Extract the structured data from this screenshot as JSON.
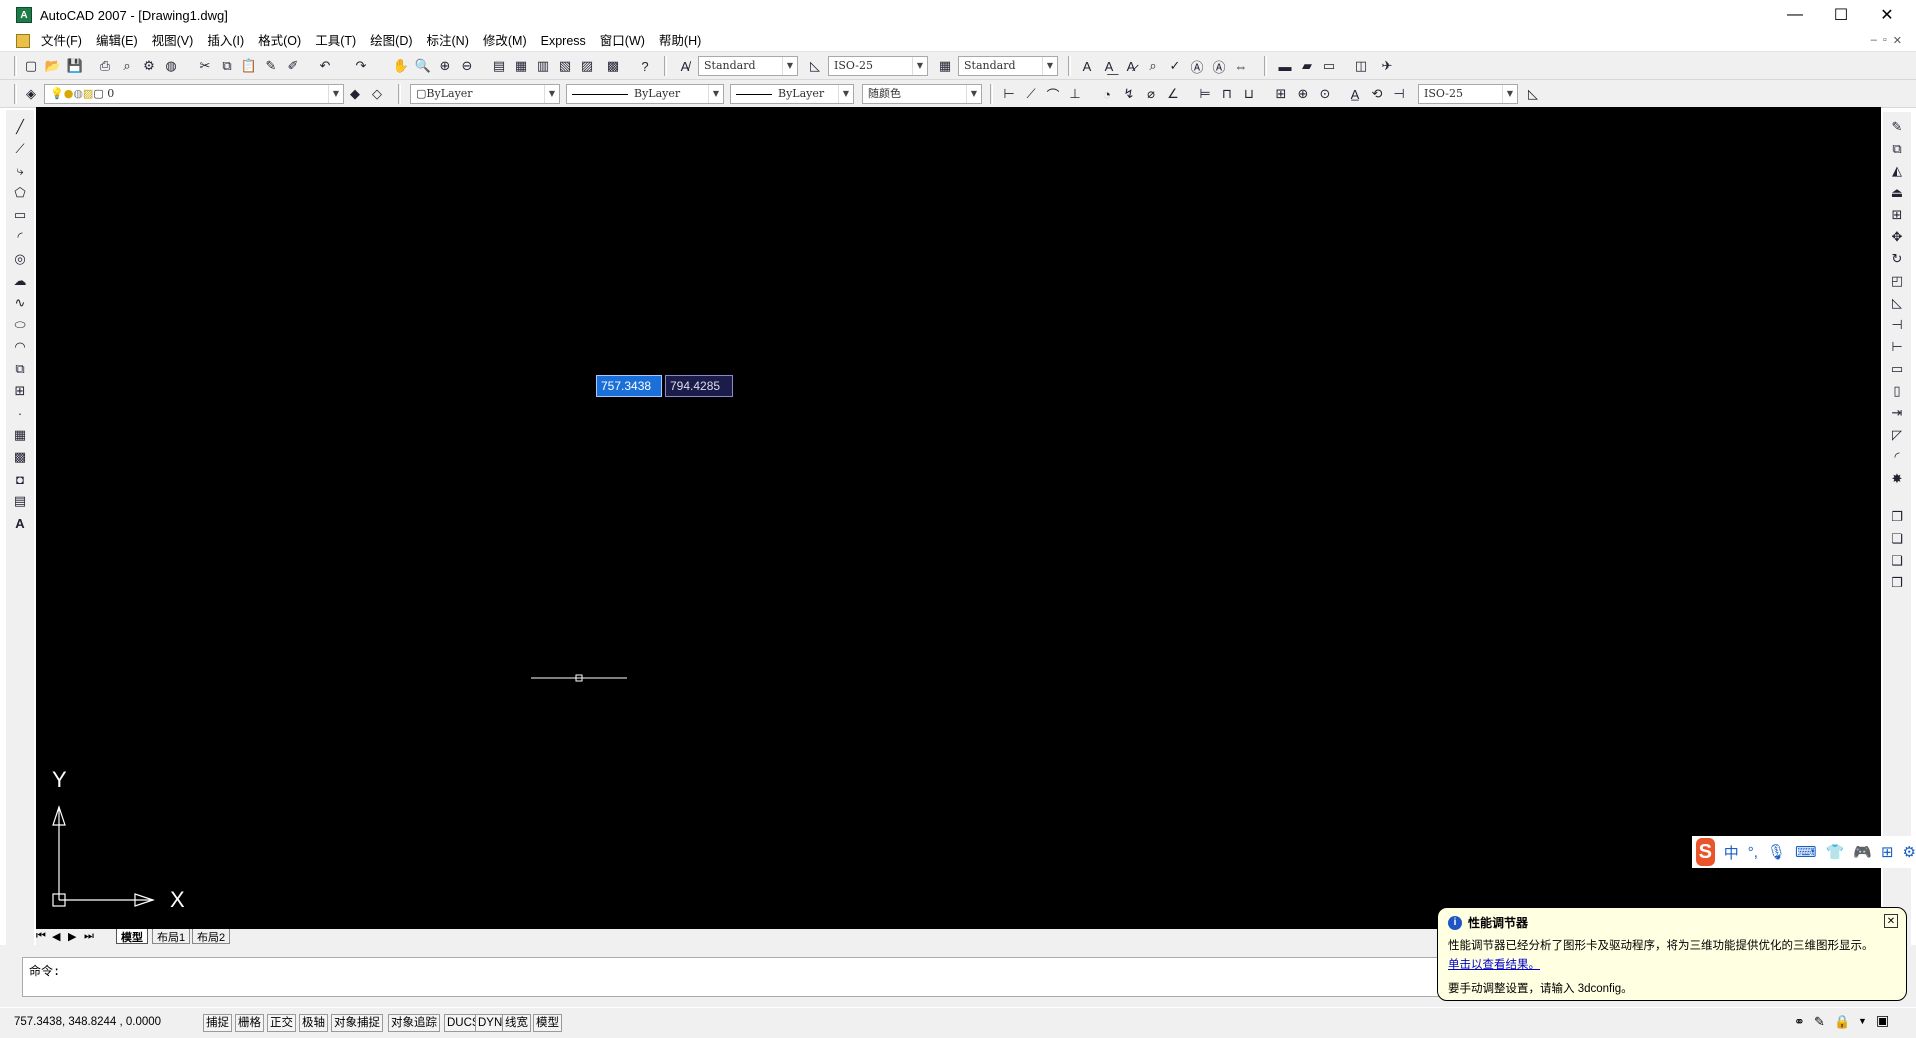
{
  "window": {
    "title": "AutoCAD 2007 - [Drawing1.dwg]",
    "logo_icon": "autocad-logo-icon",
    "controls": {
      "minimize": "—",
      "maximize": "☐",
      "close": "✕"
    }
  },
  "menubar": {
    "items": [
      "文件(F)",
      "编辑(E)",
      "视图(V)",
      "插入(I)",
      "格式(O)",
      "工具(T)",
      "绘图(D)",
      "标注(N)",
      "修改(M)",
      "Express",
      "窗口(W)",
      "帮助(H)"
    ],
    "mdi_controls": [
      "–",
      "▫",
      "✕"
    ]
  },
  "toolbar1": {
    "text_style": "Standard",
    "dim_style": "ISO-25",
    "table_style": "Standard"
  },
  "toolbar2": {
    "layer": "0",
    "color": "ByLayer",
    "linetype": "ByLayer",
    "lineweight": "ByLayer",
    "plotstyle": "随颜色",
    "dim_style": "ISO-25"
  },
  "canvas": {
    "background": "#000000",
    "dyn_input_1": "757.3438",
    "dyn_input_2": "794.4285",
    "ucs_x_label": "X",
    "ucs_y_label": "Y"
  },
  "tabs": {
    "items": [
      "模型",
      "布局1",
      "布局2"
    ],
    "active": "模型"
  },
  "command": {
    "prompt": "命令:"
  },
  "status": {
    "coords": "757.3438,  348.8244 , 0.0000",
    "buttons": [
      "捕捉",
      "栅格",
      "正交",
      "极轴",
      "对象捕捉",
      "对象追踪",
      "DUCS",
      "DYN",
      "线宽",
      "模型"
    ]
  },
  "balloon": {
    "title": "性能调节器",
    "line1": "性能调节器已经分析了图形卡及驱动程序，将为三维功能提供优化的三维图形显示。",
    "link": "单击以查看结果。",
    "line3": "要手动调整设置，请输入 3dconfig。"
  },
  "ime": {
    "logo": "S",
    "mode": "中",
    "punct": "°,"
  }
}
